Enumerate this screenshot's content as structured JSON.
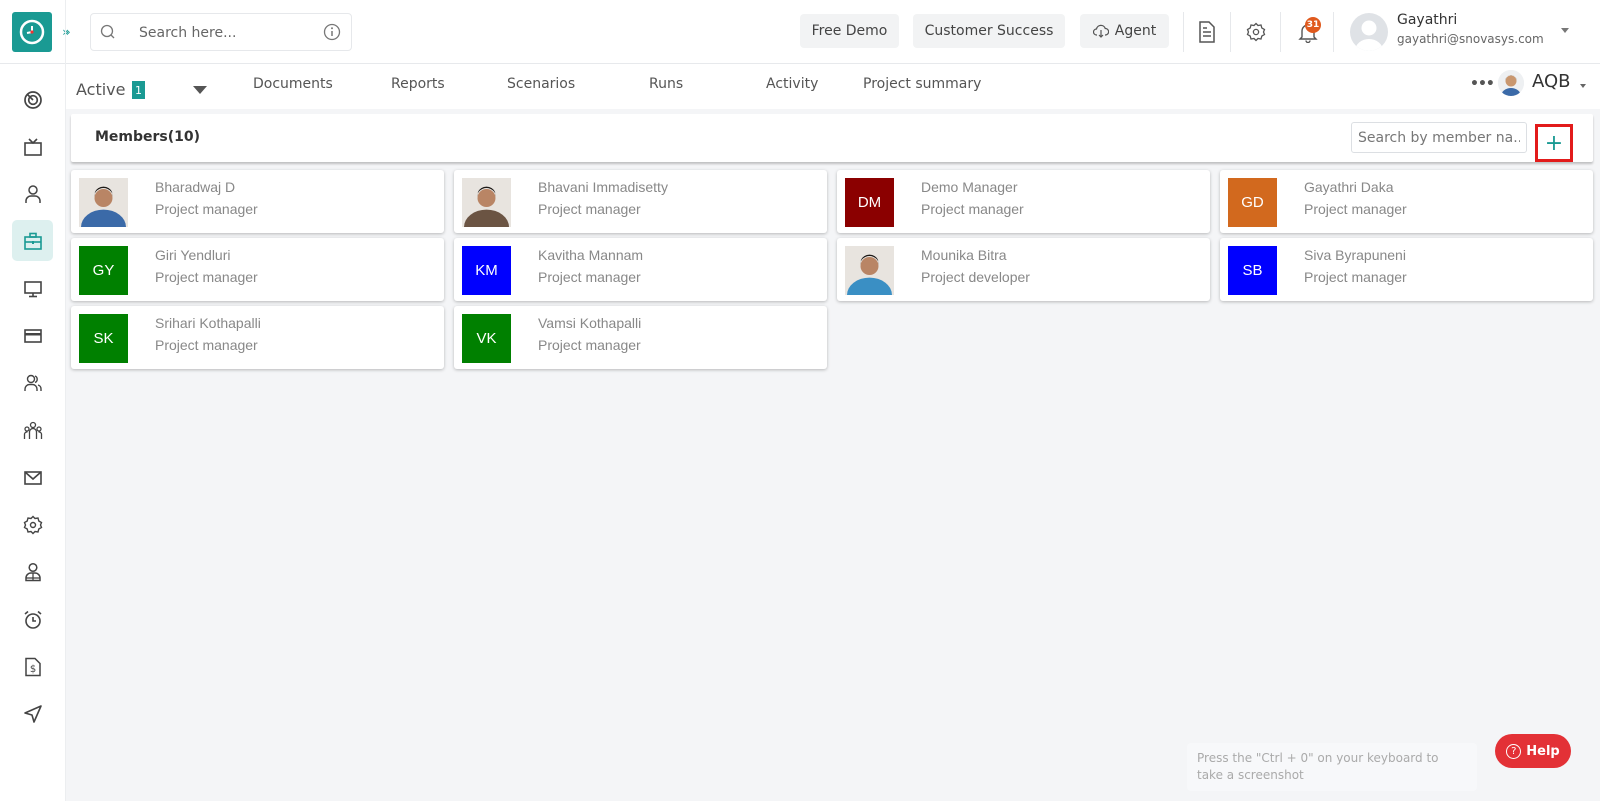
{
  "header": {
    "search_placeholder": "Search here...",
    "buttons": {
      "free_demo": "Free Demo",
      "customer_success": "Customer Success",
      "agent": "Agent"
    },
    "notification_count": "31",
    "user": {
      "name": "Gayathri",
      "email": "gayathri@snovasys.com"
    }
  },
  "sidebar": {
    "items": [
      {
        "icon": "dashboard-icon"
      },
      {
        "icon": "tv-icon"
      },
      {
        "icon": "user-icon"
      },
      {
        "icon": "briefcase-icon",
        "active": true
      },
      {
        "icon": "monitor-icon"
      },
      {
        "icon": "credit-card-icon"
      },
      {
        "icon": "users-icon"
      },
      {
        "icon": "team-icon"
      },
      {
        "icon": "mail-icon"
      },
      {
        "icon": "gear-icon"
      },
      {
        "icon": "user-badge-icon"
      },
      {
        "icon": "alarm-clock-icon"
      },
      {
        "icon": "invoice-icon"
      },
      {
        "icon": "send-icon"
      }
    ]
  },
  "subnav": {
    "status_label": "Active",
    "status_count": "1",
    "tabs": [
      "Documents",
      "Reports",
      "Scenarios",
      "Runs",
      "Activity",
      "Project summary"
    ],
    "more": "•••",
    "project_code": "AQB"
  },
  "members": {
    "title": "Members(10)",
    "search_placeholder": "Search by member na...",
    "add_label": "+",
    "list": [
      {
        "name": "Bharadwaj D",
        "role": "Project manager",
        "initials": "",
        "photo": true,
        "color": "#3b6aa8"
      },
      {
        "name": "Bhavani Immadisetty",
        "role": "Project manager",
        "initials": "",
        "photo": true,
        "color": "#6b5443"
      },
      {
        "name": "Demo Manager",
        "role": "Project manager",
        "initials": "DM",
        "photo": false,
        "color": "#8b0000"
      },
      {
        "name": "Gayathri Daka",
        "role": "Project manager",
        "initials": "GD",
        "photo": false,
        "color": "#d2691e"
      },
      {
        "name": "Giri Yendluri",
        "role": "Project manager",
        "initials": "GY",
        "photo": false,
        "color": "#008000"
      },
      {
        "name": "Kavitha Mannam",
        "role": "Project manager",
        "initials": "KM",
        "photo": false,
        "color": "#0000ff"
      },
      {
        "name": "Mounika Bitra",
        "role": "Project developer",
        "initials": "",
        "photo": true,
        "color": "#3a8fc4"
      },
      {
        "name": "Siva Byrapuneni",
        "role": "Project manager",
        "initials": "SB",
        "photo": false,
        "color": "#0000ff"
      },
      {
        "name": "Srihari Kothapalli",
        "role": "Project manager",
        "initials": "SK",
        "photo": false,
        "color": "#008000"
      },
      {
        "name": "Vamsi Kothapalli",
        "role": "Project manager",
        "initials": "VK",
        "photo": false,
        "color": "#008000"
      }
    ]
  },
  "footer": {
    "hint": "Press the \"Ctrl + 0\" on your keyboard to take a screenshot",
    "help_label": "Help"
  },
  "colors": {
    "brand": "#1a9a93",
    "help": "#e33136",
    "highlight": "#e21b1b"
  }
}
